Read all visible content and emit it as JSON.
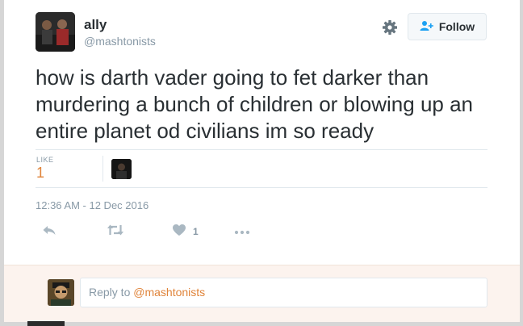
{
  "tweet": {
    "display_name": "ally",
    "handle": "@mashtonists",
    "text": "how is darth vader going to fet darker than murdering a bunch of children or blowing up an entire planet od civilians  im so ready",
    "timestamp": "12:36 AM - 12 Dec 2016"
  },
  "follow_button": {
    "label": "Follow"
  },
  "stats": {
    "likes_label": "LIKE",
    "likes_count": "1"
  },
  "actions": {
    "like_count": "1"
  },
  "reply": {
    "prefix": "Reply to ",
    "mention": "@mashtonists"
  },
  "colors": {
    "accent": "#e0843a",
    "text": "#292f33",
    "muted": "#8899a6",
    "reply_bg": "#fcf3ee"
  },
  "icons": [
    "gear-icon",
    "follow-person-icon",
    "reply-icon",
    "retweet-icon",
    "heart-icon",
    "more-icon"
  ]
}
